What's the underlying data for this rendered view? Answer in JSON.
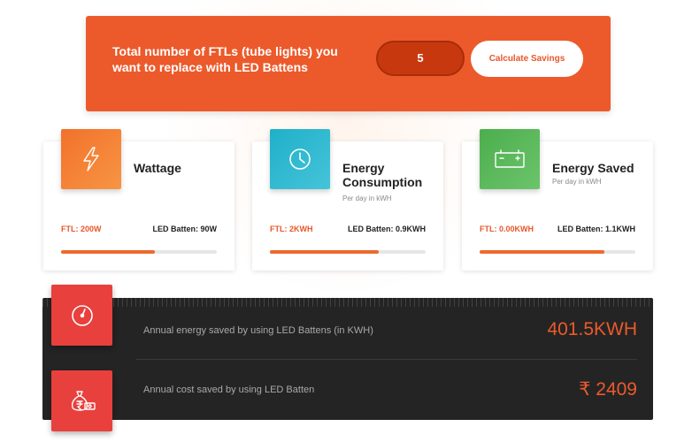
{
  "banner": {
    "prompt": "Total number of FTLs (tube lights) you want to replace with LED Battens",
    "ftl_count": "5",
    "button_label": "Calculate Savings"
  },
  "cards": [
    {
      "title": "Wattage",
      "subtitle": "",
      "icon": "lightning-icon",
      "color": "#f07a30",
      "ftl_label": "FTL: 200W",
      "led_label": "LED Batten: 90W",
      "progress": 0.6
    },
    {
      "title": "Energy Consumption",
      "subtitle": "Per day in kWH",
      "icon": "clock-icon",
      "color": "#2fb4cc",
      "ftl_label": "FTL: 2KWH",
      "led_label": "LED Batten: 0.9KWH",
      "progress": 0.7
    },
    {
      "title": "Energy Saved",
      "subtitle": "Per day in kWH",
      "icon": "battery-icon",
      "color": "#5cb85c",
      "ftl_label": "FTL: 0.00KWH",
      "led_label": "LED Batten: 1.1KWH",
      "progress": 0.8
    }
  ],
  "summary": {
    "energy_label": "Annual energy saved by using LED Battens (in KWH)",
    "energy_value": "401.5KWH",
    "cost_label": "Annual cost saved by using LED Batten",
    "cost_value": "₹ 2409"
  },
  "colors": {
    "accent": "#ec5a2b",
    "dark_panel": "#242424",
    "red_icon": "#e8403d"
  }
}
